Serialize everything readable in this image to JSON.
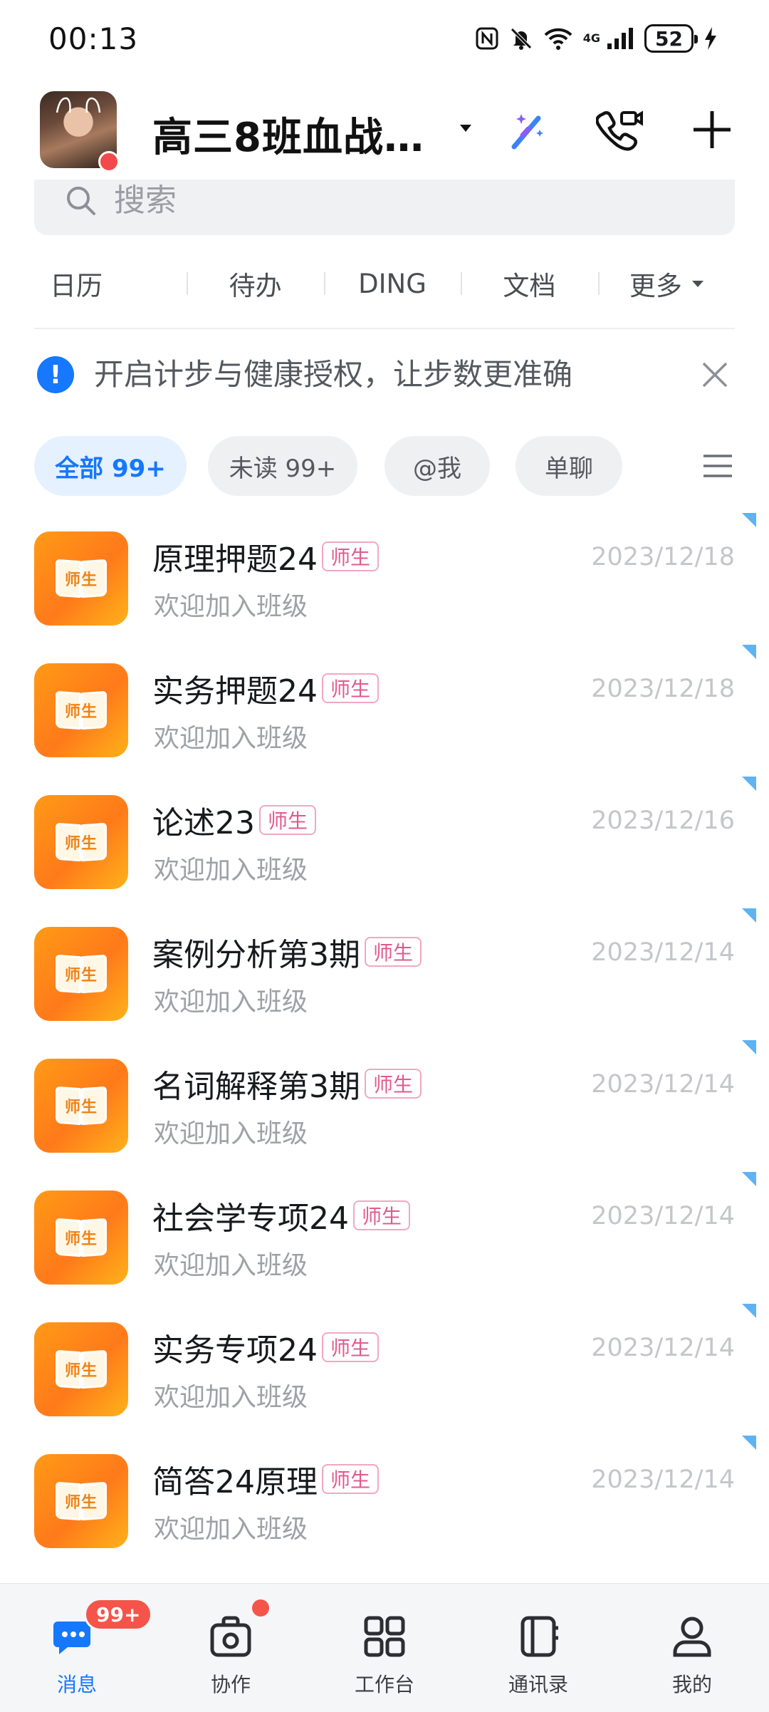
{
  "status_bar": {
    "time": "00:13",
    "network": "4G",
    "battery": "52",
    "icons": [
      "nfc-icon",
      "mute-bell-icon",
      "wifi-icon",
      "signal-icon",
      "battery-icon",
      "charging-icon"
    ]
  },
  "header": {
    "org_name": "高三8班血战…",
    "icons": [
      "magic-wand-icon",
      "video-call-icon",
      "plus-icon"
    ]
  },
  "search": {
    "placeholder": "搜索"
  },
  "shortcuts": [
    "日历",
    "待办",
    "DING",
    "文档",
    "更多"
  ],
  "notice": {
    "text": "开启计步与健康授权，让步数更准确"
  },
  "filters": [
    "全部 99+",
    "未读 99+",
    "@我",
    "单聊"
  ],
  "accent_color": "#1677ff",
  "conversations": [
    {
      "title": "原理押题24",
      "tag": "师生",
      "subtitle": "欢迎加入班级",
      "date": "2023/12/18",
      "avatar_text": "师生"
    },
    {
      "title": "实务押题24",
      "tag": "师生",
      "subtitle": "欢迎加入班级",
      "date": "2023/12/18",
      "avatar_text": "师生"
    },
    {
      "title": "论述23",
      "tag": "师生",
      "subtitle": "欢迎加入班级",
      "date": "2023/12/16",
      "avatar_text": "师生"
    },
    {
      "title": "案例分析第3期",
      "tag": "师生",
      "subtitle": "欢迎加入班级",
      "date": "2023/12/14",
      "avatar_text": "师生"
    },
    {
      "title": "名词解释第3期",
      "tag": "师生",
      "subtitle": "欢迎加入班级",
      "date": "2023/12/14",
      "avatar_text": "师生"
    },
    {
      "title": "社会学专项24",
      "tag": "师生",
      "subtitle": "欢迎加入班级",
      "date": "2023/12/14",
      "avatar_text": "师生"
    },
    {
      "title": "实务专项24",
      "tag": "师生",
      "subtitle": "欢迎加入班级",
      "date": "2023/12/14",
      "avatar_text": "师生"
    },
    {
      "title": "简答24原理",
      "tag": "师生",
      "subtitle": "欢迎加入班级",
      "date": "2023/12/14",
      "avatar_text": "师生"
    }
  ],
  "bottom_nav": {
    "items": [
      {
        "label": "消息",
        "icon": "message-icon",
        "badge": "99+"
      },
      {
        "label": "协作",
        "icon": "collab-icon"
      },
      {
        "label": "工作台",
        "icon": "workbench-icon"
      },
      {
        "label": "通讯录",
        "icon": "contacts-icon"
      },
      {
        "label": "我的",
        "icon": "profile-icon"
      }
    ]
  }
}
